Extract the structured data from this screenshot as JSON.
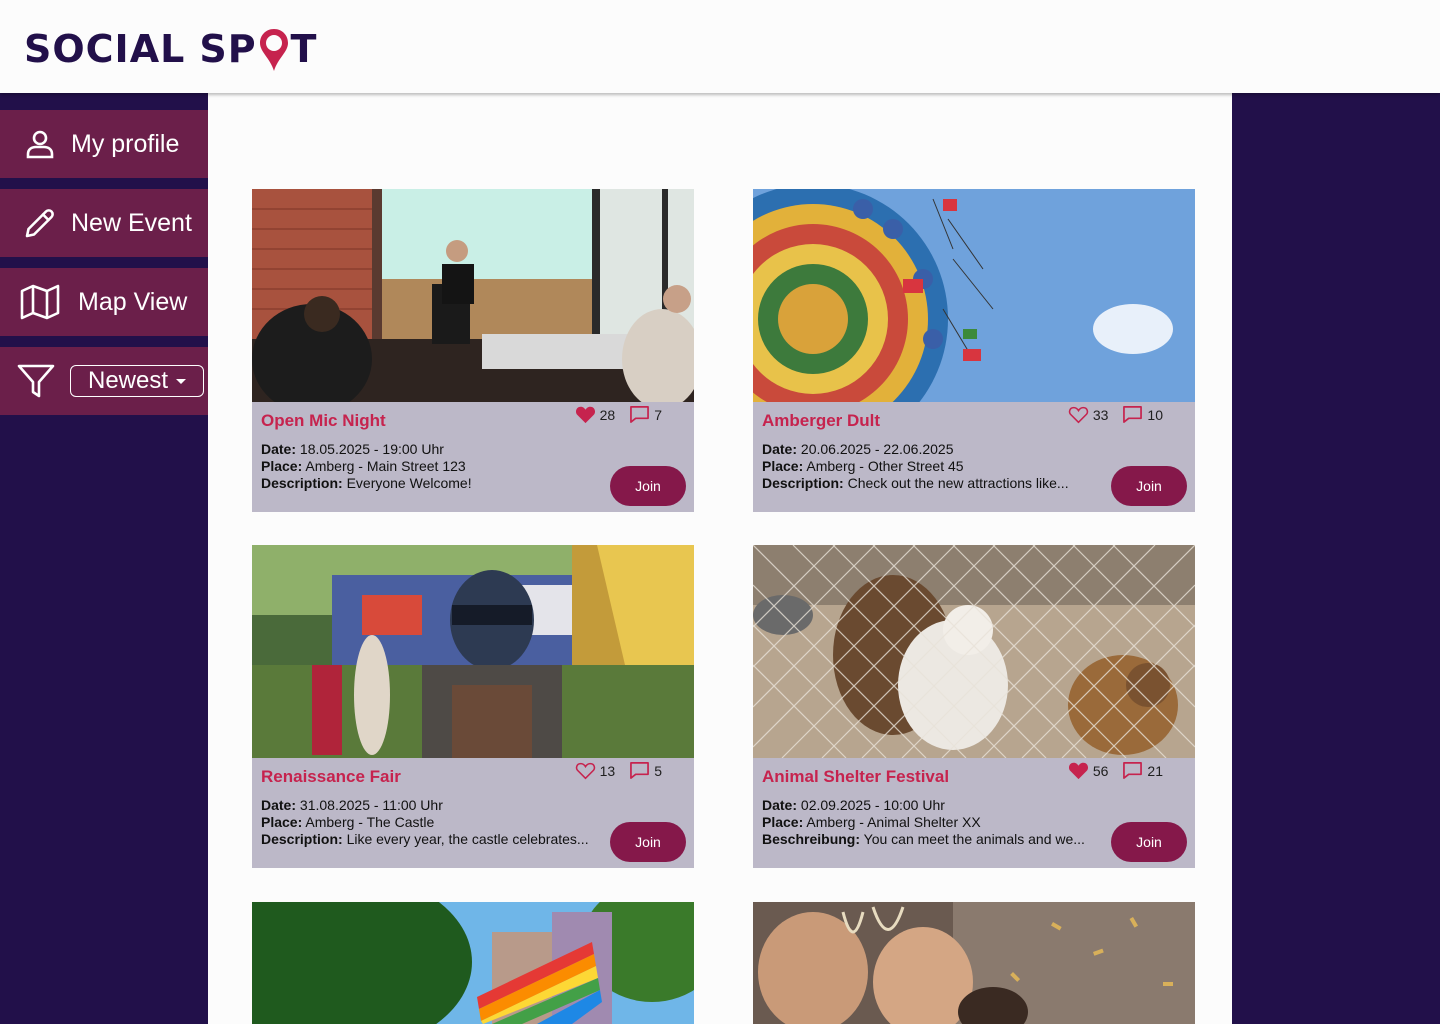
{
  "app": {
    "logo_part1": "SOCIAL",
    "logo_part2": "SP",
    "logo_part3": "T"
  },
  "colors": {
    "navy": "#22104a",
    "plum": "#6b1f4a",
    "accent": "#c6234e",
    "join": "#85184a",
    "card": "#bcb8c8"
  },
  "sidebar": {
    "items": [
      {
        "label": "My profile",
        "icon": "person-icon"
      },
      {
        "label": "New Event",
        "icon": "pencil-icon"
      },
      {
        "label": "Map View",
        "icon": "map-icon"
      }
    ],
    "filter": {
      "icon": "filter-icon",
      "selected": "Newest"
    }
  },
  "events": [
    {
      "title": "Open Mic Night",
      "likes": "28",
      "liked": true,
      "comments": "7",
      "date_label": "Date:",
      "date": "18.05.2025 - 19:00 Uhr",
      "place_label": "Place:",
      "place": "Amberg - Main Street 123",
      "desc_label": "Description:",
      "description": "Everyone Welcome!",
      "join": "Join"
    },
    {
      "title": "Amberger Dult",
      "likes": "33",
      "liked": false,
      "comments": "10",
      "date_label": "Date:",
      "date": "20.06.2025 - 22.06.2025",
      "place_label": "Place:",
      "place": "Amberg - Other Street 45",
      "desc_label": "Description:",
      "description": "Check out the new attractions like...",
      "join": "Join"
    },
    {
      "title": "Renaissance Fair",
      "likes": "13",
      "liked": false,
      "comments": "5",
      "date_label": "Date:",
      "date": "31.08.2025 - 11:00 Uhr",
      "place_label": "Place:",
      "place": "Amberg - The Castle",
      "desc_label": "Description:",
      "description": "Like every year, the castle celebrates...",
      "join": "Join"
    },
    {
      "title": "Animal Shelter Festival",
      "likes": "56",
      "liked": true,
      "comments": "21",
      "date_label": "Date:",
      "date": "02.09.2025 - 10:00 Uhr",
      "place_label": "Place:",
      "place": "Amberg - Animal Shelter XX",
      "desc_label": "Beschreibung:",
      "description": "You can meet the animals and we...",
      "join": "Join"
    }
  ]
}
